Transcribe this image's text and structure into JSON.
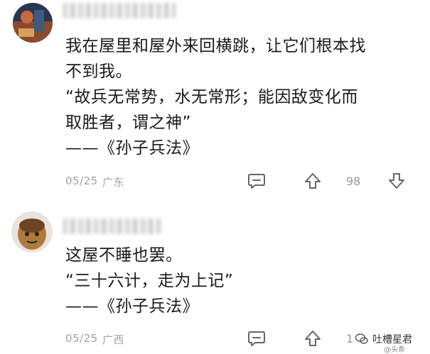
{
  "comments": [
    {
      "lines": [
        "我在屋里和屋外来回横跳，让它们根本找",
        "不到我。",
        "“故兵无常势，水无常形；能因敌变化而",
        "取胜者，谓之神”",
        "——《孙子兵法》"
      ],
      "date": "05/25",
      "location": "广东",
      "likes": "98"
    },
    {
      "lines": [
        "这屋不睡也罢。",
        "“三十六计，走为上记”",
        "——《孙子兵法》"
      ],
      "date": "05/25",
      "location": "广西",
      "likes": "1"
    }
  ],
  "watermark": {
    "text": "吐槽星君",
    "sub": "@头条"
  }
}
